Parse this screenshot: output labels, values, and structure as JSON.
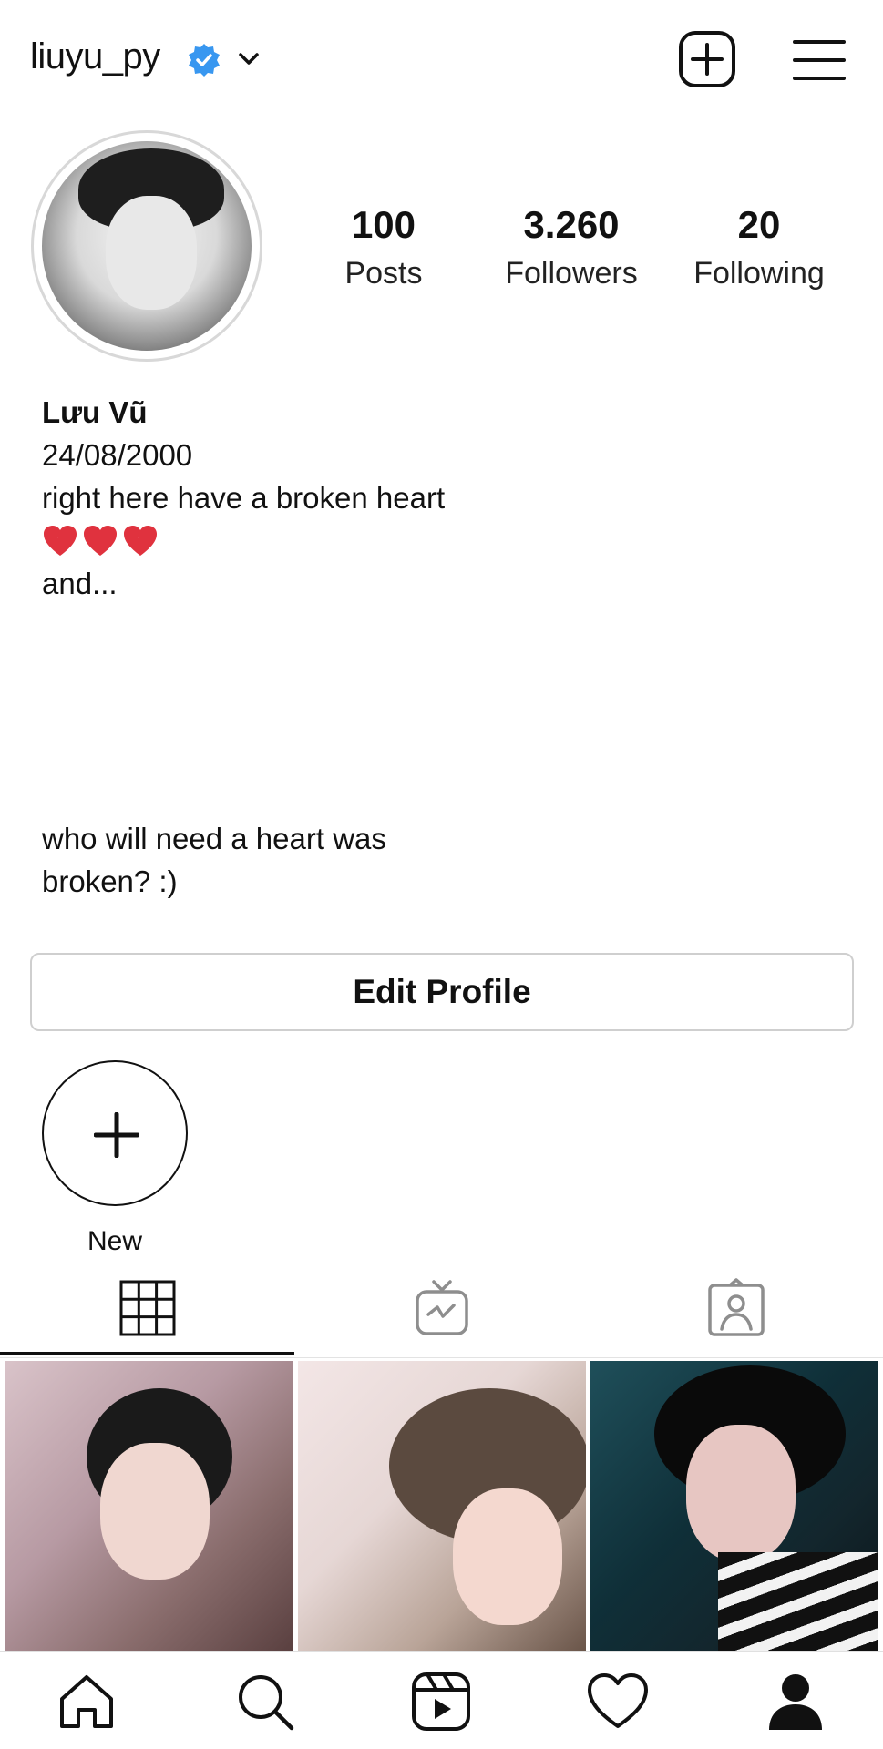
{
  "header": {
    "username": "liuyu_py",
    "verified_icon": "verified-badge",
    "dropdown_icon": "chevron-down",
    "add_icon": "plus-square",
    "menu_icon": "hamburger-menu"
  },
  "profile": {
    "stats": [
      {
        "number": "100",
        "label": "Posts"
      },
      {
        "number": "3.260",
        "label": "Followers"
      },
      {
        "number": "20",
        "label": "Following"
      }
    ],
    "name": "Lưu Vũ",
    "bio_lines": [
      "24/08/2000",
      "right here have a broken heart"
    ],
    "hearts": "💔💔💔",
    "bio_after": "and...",
    "bio_end_lines": [
      "who will need a heart was",
      "broken? :)"
    ]
  },
  "actions": {
    "edit_profile_label": "Edit Profile"
  },
  "highlights": {
    "new_label": "New"
  },
  "tabs": {
    "items": [
      "grid-icon",
      "igtv-icon",
      "tagged-icon"
    ],
    "active": "grid-icon"
  },
  "bottom_nav": {
    "items": [
      "home-icon",
      "search-icon",
      "reels-icon",
      "heart-icon",
      "profile-icon"
    ],
    "active": "profile-icon"
  },
  "colors": {
    "verified": "#3897f0",
    "broken_heart": "#e0323e",
    "border": "#cfcfcf"
  }
}
